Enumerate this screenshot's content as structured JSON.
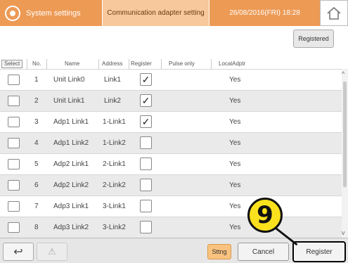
{
  "header": {
    "app_title": "System settings",
    "screen_title": "Communication adapter setting",
    "datetime": "26/08/2016(FRI) 18:28"
  },
  "toolbar": {
    "registered_label": "Registered"
  },
  "table": {
    "headers": {
      "select": "Select",
      "no": "No.",
      "name": "Name",
      "address": "Address",
      "register": "Register",
      "pulse_only": "Pulse only",
      "local_adptr": "LocalAdptr"
    },
    "rows": [
      {
        "no": "1",
        "name": "Unit Link0",
        "address": "Link1",
        "register": "✓",
        "local": "Yes"
      },
      {
        "no": "2",
        "name": "Unit Link1",
        "address": "Link2",
        "register": "✓",
        "local": "Yes"
      },
      {
        "no": "3",
        "name": "Adp1 Link1",
        "address": "1-Link1",
        "register": "✓",
        "local": "Yes"
      },
      {
        "no": "4",
        "name": "Adp1 Link2",
        "address": "1-Link2",
        "register": "",
        "local": "Yes"
      },
      {
        "no": "5",
        "name": "Adp2 Link1",
        "address": "2-Link1",
        "register": "",
        "local": "Yes"
      },
      {
        "no": "6",
        "name": "Adp2 Link2",
        "address": "2-Link2",
        "register": "",
        "local": "Yes"
      },
      {
        "no": "7",
        "name": "Adp3 Link1",
        "address": "3-Link1",
        "register": "",
        "local": "Yes"
      },
      {
        "no": "8",
        "name": "Adp3 Link2",
        "address": "3-Link2",
        "register": "",
        "local": "Yes"
      }
    ]
  },
  "footer": {
    "sttng_label": "Sttng",
    "cancel_label": "Cancel",
    "register_label": "Register"
  },
  "callout": {
    "number": "9"
  },
  "colors": {
    "accent": "#ed9a55",
    "accent_light": "#f7c89b",
    "callout": "#fbe11d"
  }
}
